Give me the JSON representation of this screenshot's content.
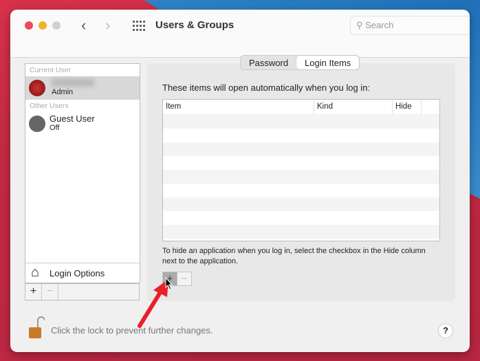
{
  "window": {
    "title": "Users & Groups",
    "search_placeholder": "Search"
  },
  "sidebar": {
    "current_user_header": "Current User",
    "current_user_role": "Admin",
    "other_users_header": "Other Users",
    "guest": {
      "name": "Guest User",
      "status": "Off"
    },
    "login_options": "Login Options",
    "add": "+",
    "remove": "−"
  },
  "tabs": [
    {
      "label": "Password",
      "active": false
    },
    {
      "label": "Login Items",
      "active": true
    }
  ],
  "main": {
    "intro": "These items will open automatically when you log in:",
    "columns": [
      "Item",
      "Kind",
      "Hide"
    ],
    "rows": [],
    "hint": "To hide an application when you log in, select the checkbox in the Hide column next to the application.",
    "add": "+",
    "remove": "−"
  },
  "footer": {
    "lock_text": "Click the lock to prevent further changes.",
    "help": "?"
  },
  "colors": {
    "close": "#ec4b5a",
    "minimize": "#f1b22a",
    "zoom": "#d0d0d0",
    "annotation_arrow": "#e8202a"
  }
}
